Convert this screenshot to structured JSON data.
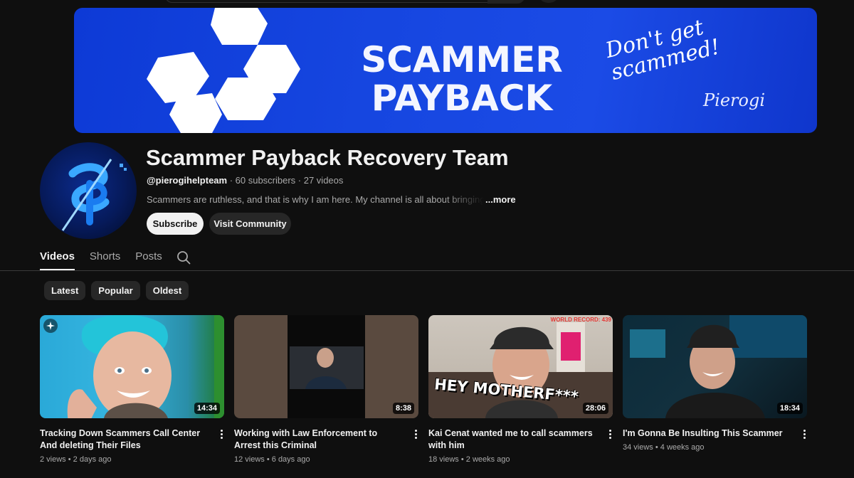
{
  "banner": {
    "title_line1": "SCAMMER",
    "title_line2": "PAYBACK",
    "tagline": "Don't get scammed!",
    "signature": "Pierogi"
  },
  "channel": {
    "name": "Scammer Payback Recovery Team",
    "handle": "@pierogihelpteam",
    "subscribers": " · 60 subscribers",
    "videos": " · 27 videos",
    "description": "Scammers are ruthless, and that is why I am here. My channel is all about bringing aware",
    "more_label": "...more"
  },
  "actions": {
    "subscribe_label": "Subscribe",
    "community_label": "Visit Community"
  },
  "tabs": [
    {
      "label": "Videos",
      "active": true
    },
    {
      "label": "Shorts",
      "active": false
    },
    {
      "label": "Posts",
      "active": false
    }
  ],
  "chips": [
    "Latest",
    "Popular",
    "Oldest"
  ],
  "videos": [
    {
      "title": "Tracking Down Scammers Call Center And deleting Their Files",
      "duration": "14:34",
      "views": "2 views",
      "age": "2 days ago"
    },
    {
      "title": "Working with Law Enforcement to Arrest this Criminal",
      "duration": "8:38",
      "views": "12 views",
      "age": "6 days ago"
    },
    {
      "title": "Kai Cenat wanted me to call scammers with him",
      "duration": "28:06",
      "views": "18 views",
      "age": "2 weeks ago",
      "overlay_text": "HEY MOTHERF***",
      "corner_text": "WORLD RECORD: 439"
    },
    {
      "title": "I'm Gonna Be Insulting This Scammer",
      "duration": "18:34",
      "views": "34 views",
      "age": "4 weeks ago"
    }
  ],
  "colors": {
    "background": "#0f0f0f",
    "banner_blue": "#1646e0",
    "chip_bg": "#272727",
    "text_secondary": "#aaaaaa"
  }
}
